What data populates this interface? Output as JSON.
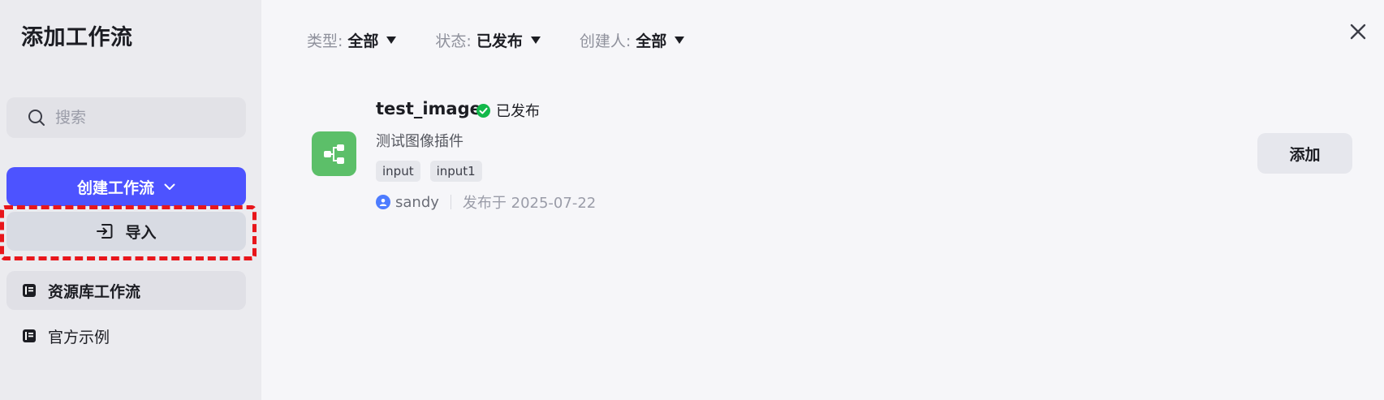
{
  "sidebar": {
    "title": "添加工作流",
    "search": {
      "placeholder": "搜索",
      "value": ""
    },
    "create_button": {
      "label": "创建工作流"
    },
    "import_button": {
      "label": "导入"
    },
    "nav_items": [
      {
        "label": "资源库工作流",
        "icon": "library-icon",
        "active": true
      },
      {
        "label": "官方示例",
        "icon": "library-icon",
        "active": false
      }
    ]
  },
  "filters": [
    {
      "label": "类型:",
      "value": "全部"
    },
    {
      "label": "状态:",
      "value": "已发布"
    },
    {
      "label": "创建人:",
      "value": "全部"
    }
  ],
  "workflows": [
    {
      "name": "test_image",
      "status": "已发布",
      "description": "测试图像插件",
      "tags": [
        "input",
        "input1"
      ],
      "author": "sandy",
      "published": "发布于 2025-07-22",
      "add_label": "添加"
    }
  ],
  "colors": {
    "accent": "#4d53ff",
    "success": "#12b84a",
    "workflow_icon_bg": "#5cbf69",
    "highlight": "#e8161b"
  },
  "icons": {
    "search": "search-icon",
    "chevron": "chevron-down-icon",
    "import": "import-icon",
    "close": "close-icon",
    "workflow": "workflow-icon",
    "status": "check-circle-icon",
    "avatar": "user-icon"
  }
}
